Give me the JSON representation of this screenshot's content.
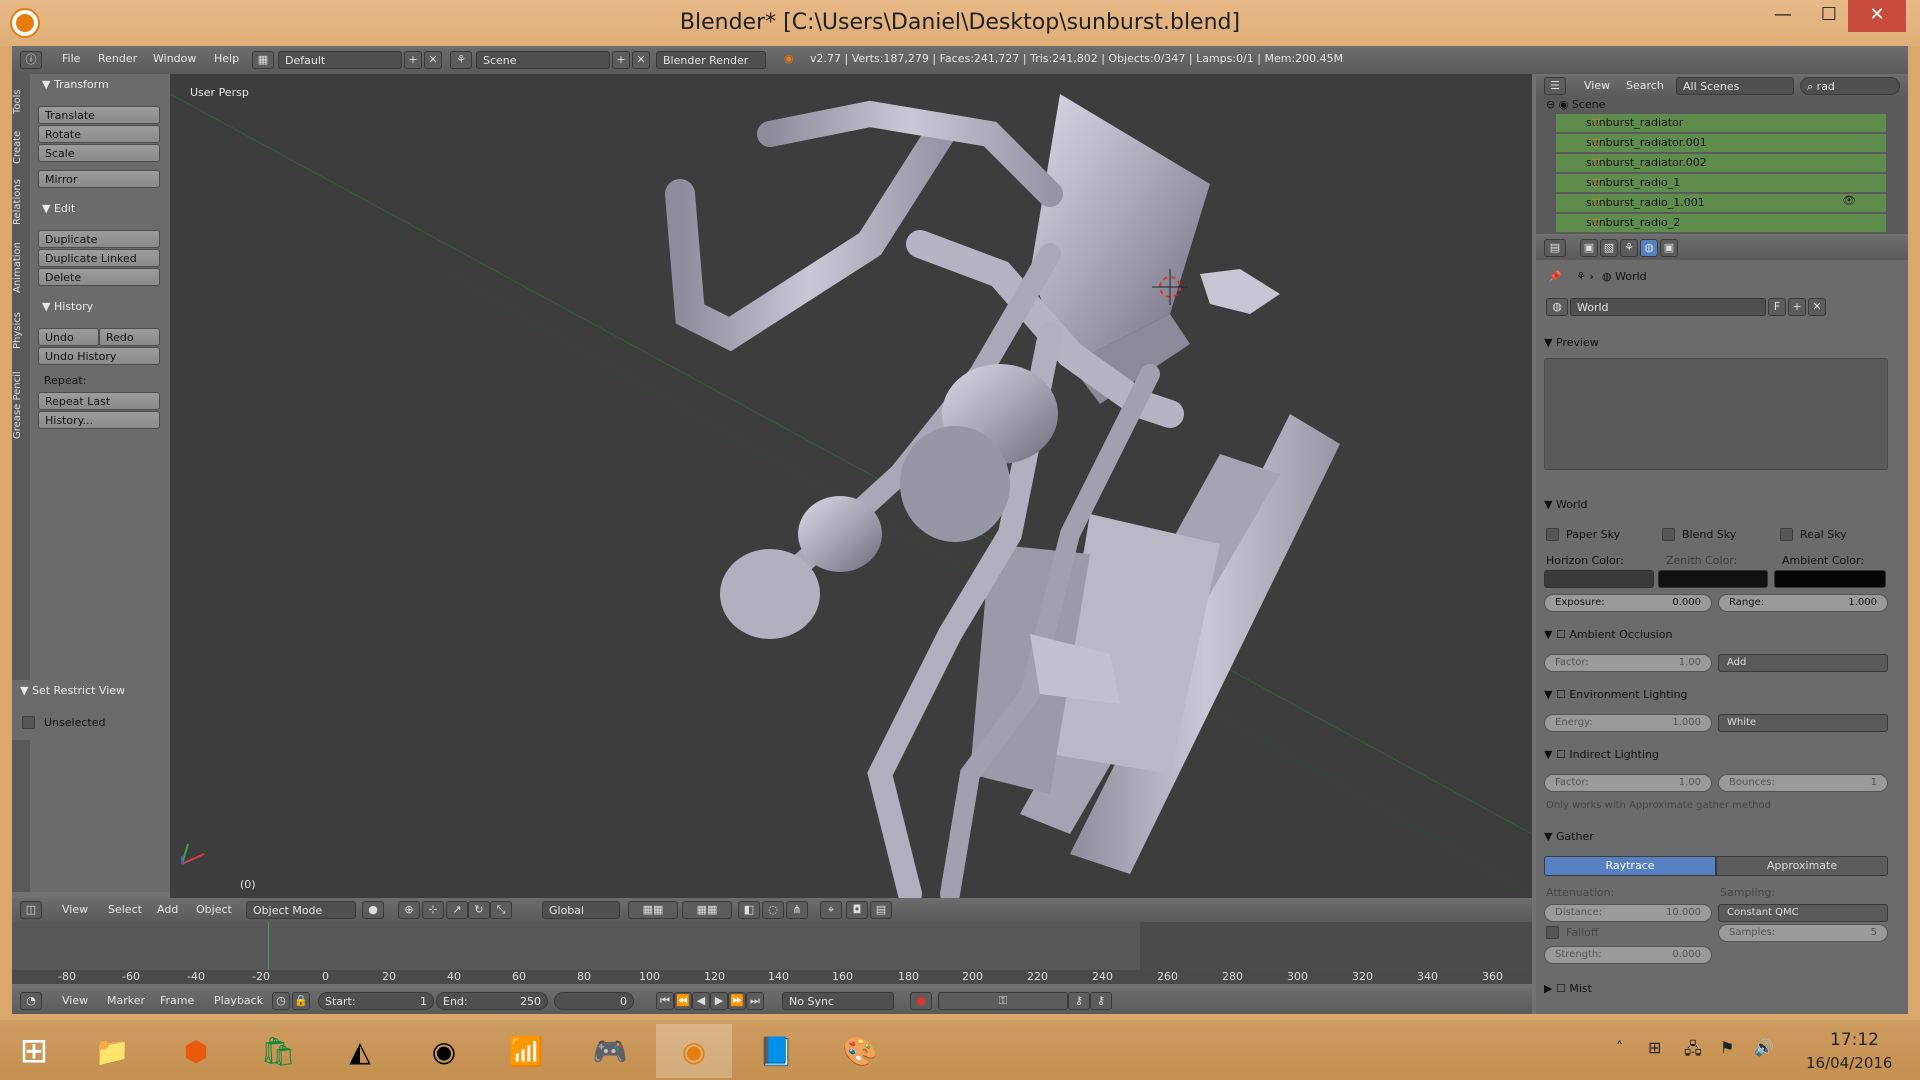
{
  "window": {
    "title": "Blender* [C:\\Users\\Daniel\\Desktop\\sunburst.blend]",
    "minimize": "—",
    "maximize": "☐",
    "close": "✕"
  },
  "info_bar": {
    "menus": [
      "File",
      "Render",
      "Window",
      "Help"
    ],
    "layout": "Default",
    "scene": "Scene",
    "engine": "Blender Render",
    "stats": "v2.77 | Verts:187,279 | Faces:241,727 | Tris:241,802 | Objects:0/347 | Lamps:0/1 | Mem:200.45M"
  },
  "tool_shelf": {
    "tabs": [
      "Tools",
      "Create",
      "Relations",
      "Animation",
      "Physics",
      "Grease Pencil"
    ],
    "transform": {
      "header": "Transform",
      "buttons": [
        "Translate",
        "Rotate",
        "Scale",
        "Mirror"
      ]
    },
    "edit": {
      "header": "Edit",
      "buttons": [
        "Duplicate",
        "Duplicate Linked",
        "Delete"
      ]
    },
    "history": {
      "header": "History",
      "undo": "Undo",
      "redo": "Redo",
      "undo_history": "Undo History",
      "repeat": "Repeat:",
      "repeat_last": "Repeat Last",
      "history_btn": "History..."
    },
    "restrict": {
      "header": "Set Restrict View",
      "unselected": "Unselected"
    }
  },
  "viewport": {
    "label": "User Persp",
    "frame": "(0)",
    "header": {
      "menus": [
        "View",
        "Select",
        "Add",
        "Object"
      ],
      "mode": "Object Mode",
      "orientation": "Global"
    }
  },
  "timeline": {
    "ticks": [
      "-80",
      "-60",
      "-40",
      "-20",
      "0",
      "20",
      "40",
      "60",
      "80",
      "100",
      "120",
      "140",
      "160",
      "180",
      "200",
      "220",
      "240",
      "260",
      "280",
      "300",
      "320",
      "340",
      "360"
    ],
    "menus": [
      "View",
      "Marker",
      "Frame",
      "Playback"
    ],
    "start_label": "Start:",
    "start": "1",
    "end_label": "End:",
    "end": "250",
    "current": "0",
    "sync": "No Sync"
  },
  "outliner": {
    "menus": [
      "View",
      "Search"
    ],
    "scenes": "All Scenes",
    "search": "rad",
    "root": "Scene",
    "items": [
      "sunburst_radiator",
      "sunburst_radiator.001",
      "sunburst_radiator.002",
      "sunburst_radio_1",
      "sunburst_radio_1.001",
      "sunburst_radio_2"
    ]
  },
  "properties": {
    "breadcrumb": "World",
    "world_name": "World",
    "fake_user": "F",
    "preview": "Preview",
    "world_section": {
      "header": "World",
      "paper_sky": "Paper Sky",
      "blend_sky": "Blend Sky",
      "real_sky": "Real Sky",
      "horizon": "Horizon Color:",
      "zenith": "Zenith Color:",
      "ambient": "Ambient Color:",
      "exposure_label": "Exposure:",
      "exposure": "0.000",
      "range_label": "Range:",
      "range": "1.000"
    },
    "ao": {
      "header": "Ambient Occlusion",
      "factor_label": "Factor:",
      "factor": "1.00",
      "mode": "Add"
    },
    "env": {
      "header": "Environment Lighting",
      "energy_label": "Energy:",
      "energy": "1.000",
      "mode": "White"
    },
    "indirect": {
      "header": "Indirect Lighting",
      "factor_label": "Factor:",
      "factor": "1.00",
      "bounces_label": "Bounces:",
      "bounces": "1",
      "note": "Only works with Approximate gather method"
    },
    "gather": {
      "header": "Gather",
      "raytrace": "Raytrace",
      "approximate": "Approximate",
      "attenuation": "Attenuation:",
      "sampling": "Sampling:",
      "distance_label": "Distance:",
      "distance": "10.000",
      "method": "Constant QMC",
      "falloff": "Falloff",
      "samples_label": "Samples:",
      "samples": "5",
      "strength_label": "Strength:",
      "strength": "0.000"
    },
    "mist": {
      "header": "Mist"
    }
  },
  "taskbar": {
    "time": "17:12",
    "date": "16/04/2016"
  },
  "colors": {
    "accent": "#e87d0d",
    "outliner_row": "#5f8c4d",
    "active_toggle": "#5680c2"
  }
}
